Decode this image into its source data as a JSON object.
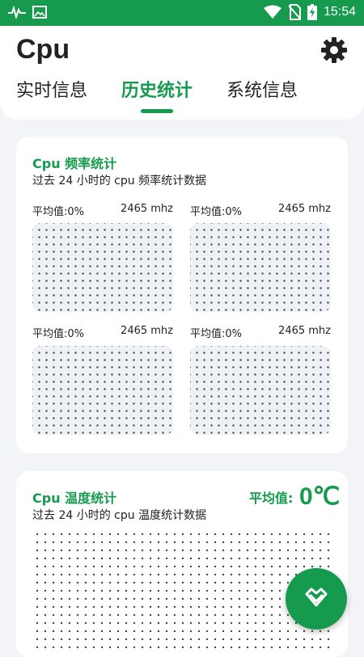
{
  "status_bar": {
    "time": "15:54",
    "icons": [
      "pulse-icon",
      "image-icon",
      "wifi-icon",
      "no-sim-icon",
      "battery-charging-icon"
    ]
  },
  "header": {
    "title": "Cpu",
    "settings_icon": "gear-icon",
    "tabs": [
      {
        "label": "实时信息",
        "active": false
      },
      {
        "label": "历史统计",
        "active": true
      },
      {
        "label": "系统信息",
        "active": false
      }
    ]
  },
  "freq_card": {
    "title": "Cpu 频率统计",
    "subtitle": "过去 24 小时的 cpu 频率统计数据",
    "panels": [
      {
        "avg_label": "平均值:0%",
        "freq": "2465 mhz"
      },
      {
        "avg_label": "平均值:0%",
        "freq": "2465 mhz"
      },
      {
        "avg_label": "平均值:0%",
        "freq": "2465 mhz"
      },
      {
        "avg_label": "平均值:0%",
        "freq": "2465 mhz"
      }
    ]
  },
  "temp_card": {
    "title": "Cpu 温度统计",
    "subtitle": "过去 24 小时的 cpu 温度统计数据",
    "avg_label": "平均值:",
    "avg_value": "0℃"
  },
  "fab": {
    "icon": "chevron-down-heart-icon"
  },
  "colors": {
    "accent": "#169b4e",
    "background": "#f2f4f8",
    "card": "#ffffff"
  }
}
